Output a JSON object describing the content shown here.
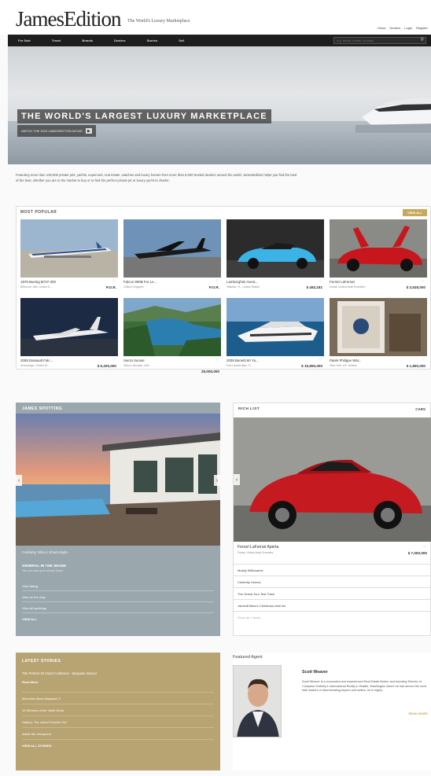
{
  "header": {
    "logo": "JamesEdition",
    "tagline": "The World's Luxury Marketplace",
    "top_links": [
      "Home",
      "Dealers",
      "Login",
      "Register"
    ]
  },
  "nav": {
    "items": [
      "For Sale",
      "Travel",
      "Brands",
      "Dealers",
      "Stories",
      "Sell"
    ],
    "search_placeholder": "e.g. brand, model, location"
  },
  "hero": {
    "title": "THE WORLD'S LARGEST LUXURY MARKETPLACE",
    "button_label": "WATCH THE 2013 JAMESEDITION MOVIE"
  },
  "intro": "Featuring more than 100,000 private jets, yachts, supercars, real estate, watches and luxury homes from more than 5,000 trusted dealers around the world. JamesEdition helps you find the best of the best, whether you are in the market to buy or to find the perfect private jet or luxury yacht to charter.",
  "popular": {
    "title": "MOST POPULAR",
    "view_all": "VIEW ALL",
    "items": [
      {
        "title": "1975 Boeing B737-200",
        "sub": "Bellevue, WA, United S...",
        "price": "P.O.R."
      },
      {
        "title": "Falcon 900B For Le...",
        "sub": "United Kingdom",
        "price": "P.O.R."
      },
      {
        "title": "Lamborghini Avent...",
        "sub": "Hialeah, FL, United States",
        "price": "$ 483,181"
      },
      {
        "title": "Ferrari LaFerrari",
        "sub": "Dubai, United Arab Emirates",
        "price": "$ 3,528,000"
      },
      {
        "title": "2008 Dassault Falc...",
        "sub": "Anchorage, United St...",
        "price": "$ 5,200,000"
      },
      {
        "title": "Sierra Sunset",
        "sub": "Sierra, Nevada, Unit...",
        "price": "",
        "price2": "29,000,000"
      },
      {
        "title": "2008 Benetti 60 Ya...",
        "sub": "Fort Lauderdale, FL",
        "price": "$ 15,850,000"
      },
      {
        "title": "Patek Philippe Wat...",
        "sub": "New York, NY, United...",
        "price": "$ 1,800,000"
      }
    ]
  },
  "spotting": {
    "title": "JAMES SPOTTING",
    "caption": "Celebrity Villa in Shark Bight",
    "subtitle": "GENERAL IN THE SHADE",
    "text": "You can own your dream home",
    "links": [
      "View listing",
      "View on the map",
      "View all spottings",
      "VIEW ALL"
    ]
  },
  "rich_list": {
    "title": "RICH LIST",
    "category": "CARS",
    "name": "Ferrari LaFerrari Aperta",
    "sub": "Dubai, United Arab Emirates",
    "price": "$ 7,000,000",
    "list": [
      "Mostly Millionaires",
      "Celebrity Homes",
      "The Grand Tour Test Track",
      "JamesEdition's Christmas wish list"
    ],
    "more": "Show all 1 items"
  },
  "stories": {
    "title": "LATEST STORIES",
    "first": "The Perfect 40 Yacht Collection - Bespoke Interior",
    "read_more": "Read More",
    "list": [
      "Mercedes-Benz Maybach S",
      "10 Winners of the Yacht Show",
      "Gallery: The Latest Porsche 911",
      "Inside the Hamptons",
      "VIEW ALL STORIES"
    ]
  },
  "agent": {
    "heading": "Featured Agent",
    "name": "Scott Weaver",
    "bio": "Scott Weaver is a successful and experienced Real Estate Broker and founding Director of Compass Sotheby's International Realty in Seattle, Washington where he has served the most elite leaders of discriminating buyers and sellers, he is highly...",
    "more": "READ MORE"
  },
  "colors": {
    "nav_bg": "#1e1e1e",
    "accent_gold": "#c8a95c",
    "spot_bg": "#9aa8ae",
    "stories_bg": "#b8a373"
  }
}
